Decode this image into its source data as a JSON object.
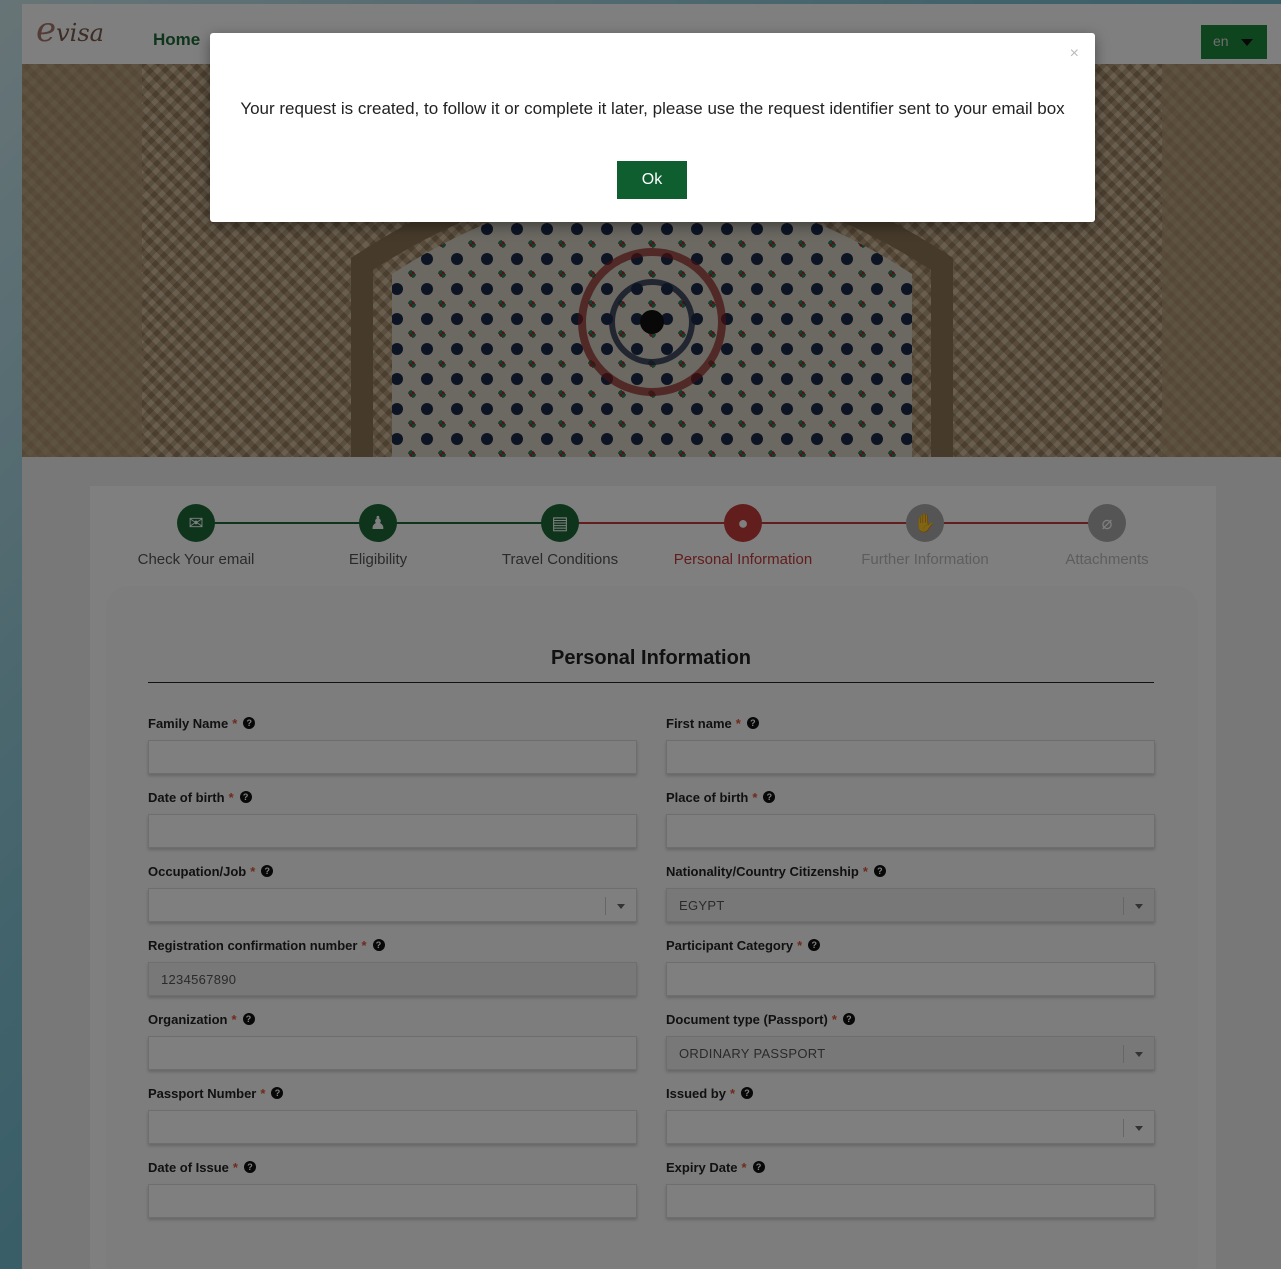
{
  "header": {
    "logo_letter": "e",
    "logo_text": "visa",
    "nav_home": "Home",
    "language": "en"
  },
  "stepper": {
    "steps": [
      {
        "label": "Check Your email",
        "icon": "envelope-icon",
        "state": "done"
      },
      {
        "label": "Eligibility",
        "icon": "user-check-icon",
        "state": "done"
      },
      {
        "label": "Travel Conditions",
        "icon": "document-icon",
        "state": "done"
      },
      {
        "label": "Personal Information",
        "icon": "user-icon",
        "state": "active"
      },
      {
        "label": "Further Information",
        "icon": "hand-icon",
        "state": "pending"
      },
      {
        "label": "Attachments",
        "icon": "paperclip-icon",
        "state": "pending"
      }
    ],
    "colors": {
      "done": "#1d6b38",
      "active": "#c53a3a",
      "pending": "#aaaaaa"
    }
  },
  "form": {
    "title": "Personal Information",
    "required_mark": "*",
    "fields": [
      {
        "label": "Family Name",
        "value": "",
        "type": "text"
      },
      {
        "label": "First name",
        "value": "",
        "type": "text"
      },
      {
        "label": "Date of birth",
        "value": "",
        "type": "text"
      },
      {
        "label": "Place of birth",
        "value": "",
        "type": "text"
      },
      {
        "label": "Occupation/Job",
        "value": "",
        "type": "select"
      },
      {
        "label": "Nationality/Country Citizenship",
        "value": "EGYPT",
        "type": "select"
      },
      {
        "label": "Registration confirmation number",
        "value": "1234567890",
        "type": "text"
      },
      {
        "label": "Participant Category",
        "value": "",
        "type": "text"
      },
      {
        "label": "Organization",
        "value": "",
        "type": "text"
      },
      {
        "label": "Document type (Passport)",
        "value": "ORDINARY PASSPORT",
        "type": "select"
      },
      {
        "label": "Passport Number",
        "value": "",
        "type": "text"
      },
      {
        "label": "Issued by",
        "value": "",
        "type": "select"
      },
      {
        "label": "Date of Issue",
        "value": "",
        "type": "text"
      },
      {
        "label": "Expiry Date",
        "value": "",
        "type": "text"
      }
    ]
  },
  "modal": {
    "close_symbol": "×",
    "message": "Your request is created, to follow it or complete it later, please use the request identifier sent to your email box",
    "ok_label": "Ok"
  },
  "colors": {
    "brand_green": "#1d6b38",
    "ok_button": "#0f5e30",
    "active_red": "#c53a3a"
  }
}
